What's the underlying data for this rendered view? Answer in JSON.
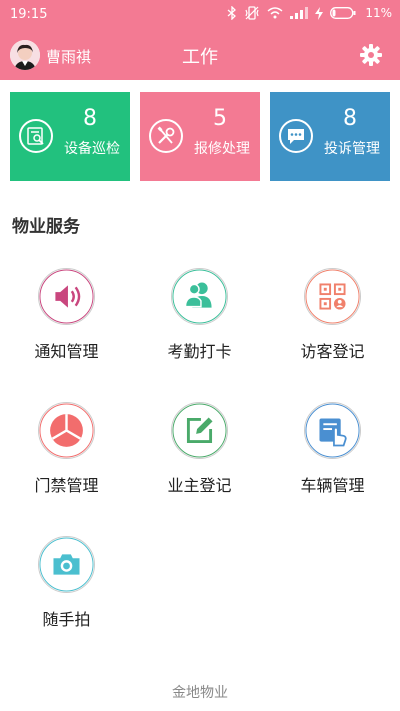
{
  "status_bar": {
    "time": "19:15",
    "battery_percent": "11%",
    "icons": [
      "bluetooth-icon",
      "vibrate-icon",
      "wifi-icon",
      "signal-icon",
      "charging-icon",
      "battery-icon"
    ]
  },
  "header": {
    "username": "曹雨祺",
    "title": "工作",
    "settings_icon": "gear-icon",
    "colors": {
      "background": "#f37a93"
    }
  },
  "stat_cards": [
    {
      "count": "8",
      "label": "设备巡检",
      "icon": "inspection-icon",
      "color": "#22c17e"
    },
    {
      "count": "5",
      "label": "报修处理",
      "icon": "repair-tools-icon",
      "color": "#f37a93"
    },
    {
      "count": "8",
      "label": "投诉管理",
      "icon": "chat-bubble-icon",
      "color": "#3f93c6"
    }
  ],
  "section_title": "物业服务",
  "services": [
    {
      "label": "通知管理",
      "icon": "speaker-icon",
      "color": "#c9467e"
    },
    {
      "label": "考勤打卡",
      "icon": "people-icon",
      "color": "#3bbf9a"
    },
    {
      "label": "访客登记",
      "icon": "qr-visitor-icon",
      "color": "#f0806b"
    },
    {
      "label": "门禁管理",
      "icon": "pie-chart-icon",
      "color": "#f26d6d"
    },
    {
      "label": "业主登记",
      "icon": "edit-icon",
      "color": "#4aaa6a"
    },
    {
      "label": "车辆管理",
      "icon": "tap-card-icon",
      "color": "#4a8fd1"
    },
    {
      "label": "随手拍",
      "icon": "camera-icon",
      "color": "#4bbfcf"
    }
  ],
  "footer": "金地物业"
}
